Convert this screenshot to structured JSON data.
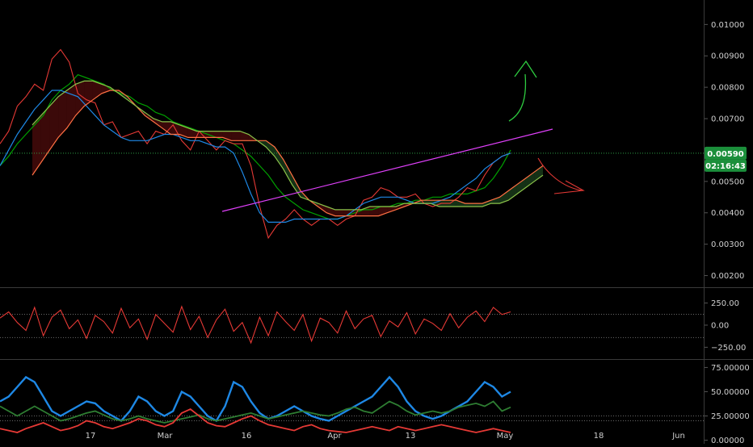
{
  "chart_data": [
    {
      "type": "line",
      "panel": "price",
      "y_ticks": [
        "0.00200",
        "0.00300",
        "0.00400",
        "0.00500",
        "0.00600",
        "0.00700",
        "0.00800",
        "0.00900",
        "0.01000"
      ],
      "y_tick_values": [
        0.002,
        0.003,
        0.004,
        0.005,
        0.006,
        0.007,
        0.008,
        0.009,
        0.01
      ],
      "ylim": [
        0.00168,
        0.01078
      ],
      "last_price_label": "0.00590",
      "last_price_value": 0.0059,
      "countdown_label": "02:16:43",
      "x_tick_labels": [
        "17",
        "Mar",
        "16",
        "Apr",
        "13",
        "May",
        "18",
        "Jun"
      ],
      "series": [
        {
          "values": [
            0.0055,
            0.0058,
            0.0062,
            0.0065,
            0.0068,
            0.0071,
            0.0076,
            0.0079,
            0.0081,
            0.0084,
            0.0083,
            0.0082,
            0.0081,
            0.0079,
            0.0078,
            0.0077,
            0.0075,
            0.0074,
            0.0072,
            0.0071,
            0.0069,
            0.0068,
            0.0067,
            0.0066,
            0.0065,
            0.0064,
            0.0063,
            0.0062,
            0.006,
            0.0058,
            0.0055,
            0.0052,
            0.0048,
            0.0045,
            0.0043,
            0.0041,
            0.004,
            0.0039,
            0.0038,
            0.0038,
            0.0039,
            0.004,
            0.0041,
            0.0041,
            0.0042,
            0.0042,
            0.0043,
            0.0043,
            0.0044,
            0.0044,
            0.0045,
            0.0045,
            0.0046,
            0.0046,
            0.0046,
            0.0047,
            0.0048,
            0.0051,
            0.0055,
            0.006
          ],
          "color": "#00a000"
        },
        {
          "values": [
            0.0062,
            0.0066,
            0.0074,
            0.0077,
            0.0081,
            0.0079,
            0.0089,
            0.0092,
            0.0088,
            0.0078,
            0.0076,
            0.0075,
            0.0068,
            0.0069,
            0.0064,
            0.0065,
            0.0066,
            0.0062,
            0.0066,
            0.0065,
            0.0068,
            0.0063,
            0.006,
            0.0066,
            0.0063,
            0.006,
            0.0063,
            0.0062,
            0.0062,
            0.0055,
            0.0042,
            0.0032,
            0.0036,
            0.0038,
            0.0041,
            0.0038,
            0.0036,
            0.0038,
            0.0038,
            0.0036,
            0.0038,
            0.0039,
            0.0044,
            0.0045,
            0.0048,
            0.0047,
            0.0045,
            0.0045,
            0.0046,
            0.0043,
            0.0042,
            0.0043,
            0.0043,
            0.0045,
            0.0048,
            0.0047,
            0.0052,
            0.0056,
            0.0058,
            0.0059
          ],
          "color": "#e53935"
        },
        {
          "values": [
            0.0055,
            0.006,
            0.0065,
            0.0069,
            0.0073,
            0.0076,
            0.0079,
            0.0079,
            0.0078,
            0.0077,
            0.0074,
            0.0071,
            0.0068,
            0.0066,
            0.0064,
            0.0063,
            0.0063,
            0.0063,
            0.0064,
            0.0065,
            0.0065,
            0.0064,
            0.0063,
            0.0063,
            0.0062,
            0.0061,
            0.0061,
            0.0059,
            0.0053,
            0.0046,
            0.004,
            0.0037,
            0.0037,
            0.0037,
            0.0038,
            0.0038,
            0.0038,
            0.0038,
            0.0038,
            0.0038,
            0.0039,
            0.0041,
            0.0043,
            0.0044,
            0.0045,
            0.0045,
            0.0045,
            0.0044,
            0.0043,
            0.0043,
            0.0043,
            0.0044,
            0.0045,
            0.0047,
            0.0049,
            0.0051,
            0.0054,
            0.0056,
            0.0058,
            0.0059
          ],
          "color": "#1e88e5"
        },
        {
          "values": [
            0.0052,
            0.0056,
            0.006,
            0.0064,
            0.0067,
            0.0071,
            0.0074,
            0.0076,
            0.0078,
            0.0079,
            0.0079,
            0.0077,
            0.0074,
            0.0071,
            0.0069,
            0.0067,
            0.0065,
            0.0065,
            0.0064,
            0.0064,
            0.0064,
            0.0064,
            0.0064,
            0.0063,
            0.0063,
            0.0063,
            0.0063,
            0.0063,
            0.0061,
            0.0057,
            0.0052,
            0.0047,
            0.0044,
            0.0042,
            0.004,
            0.0039,
            0.0039,
            0.0039,
            0.0039,
            0.0039,
            0.0039,
            0.004,
            0.0041,
            0.0042,
            0.0043,
            0.0044,
            0.0044,
            0.0044,
            0.0044,
            0.0044,
            0.0043,
            0.0043,
            0.0043,
            0.0044,
            0.0045,
            0.0047,
            0.0049,
            0.0051,
            0.0053,
            0.0055
          ],
          "color": "#ff7043"
        },
        {
          "values": [
            0.0068,
            0.0071,
            0.0074,
            0.0077,
            0.0079,
            0.0081,
            0.0082,
            0.0082,
            0.0081,
            0.008,
            0.0078,
            0.0076,
            0.0074,
            0.0072,
            0.007,
            0.0069,
            0.0069,
            0.0068,
            0.0067,
            0.0066,
            0.0066,
            0.0066,
            0.0066,
            0.0066,
            0.0066,
            0.0065,
            0.0063,
            0.0061,
            0.0058,
            0.0054,
            0.0049,
            0.0045,
            0.0044,
            0.0043,
            0.0042,
            0.0041,
            0.0041,
            0.0041,
            0.0041,
            0.0042,
            0.0042,
            0.0042,
            0.0042,
            0.0043,
            0.0043,
            0.0043,
            0.0043,
            0.0042,
            0.0042,
            0.0042,
            0.0042,
            0.0042,
            0.0042,
            0.0043,
            0.0043,
            0.0044,
            0.0046,
            0.0048,
            0.005,
            0.0052
          ],
          "color": "#8bc34a"
        }
      ]
    },
    {
      "type": "line",
      "panel": "oscillator",
      "y_ticks": [
        "250.00",
        "0.00",
        "−250.00"
      ],
      "y_tick_values": [
        250,
        0,
        -250
      ],
      "ylim": [
        -365,
        410
      ],
      "series": [
        {
          "values": [
            80,
            150,
            30,
            -60,
            200,
            -120,
            90,
            170,
            -40,
            60,
            -150,
            110,
            40,
            -90,
            190,
            -30,
            70,
            -160,
            120,
            20,
            -80,
            210,
            -50,
            100,
            -140,
            60,
            180,
            -70,
            30,
            -200,
            90,
            -120,
            150,
            40,
            -60,
            120,
            -180,
            80,
            30,
            -90,
            160,
            -40,
            70,
            110,
            -130,
            50,
            -20,
            140,
            -100,
            70,
            20,
            -60,
            130,
            -30,
            90,
            160,
            40,
            200,
            120,
            150
          ],
          "color": "#e53935"
        }
      ]
    },
    {
      "type": "line",
      "panel": "dmi-adx",
      "y_ticks": [
        "75.00000",
        "50.00000",
        "25.00000",
        "0.00000"
      ],
      "y_tick_values": [
        75,
        50,
        25,
        0
      ],
      "ylim": [
        -2,
        82
      ],
      "series": [
        {
          "values": [
            40,
            45,
            55,
            65,
            60,
            45,
            30,
            25,
            30,
            35,
            40,
            38,
            30,
            25,
            20,
            30,
            45,
            40,
            30,
            25,
            30,
            50,
            45,
            35,
            25,
            20,
            35,
            60,
            55,
            40,
            28,
            22,
            25,
            30,
            35,
            30,
            25,
            22,
            20,
            25,
            30,
            35,
            40,
            45,
            55,
            65,
            55,
            40,
            30,
            25,
            22,
            25,
            30,
            35,
            40,
            50,
            60,
            55,
            45,
            50
          ],
          "color": "#1e88e5"
        },
        {
          "values": [
            35,
            30,
            25,
            30,
            35,
            30,
            25,
            20,
            22,
            25,
            28,
            30,
            26,
            22,
            20,
            22,
            25,
            22,
            20,
            18,
            20,
            22,
            24,
            26,
            22,
            20,
            22,
            24,
            26,
            28,
            25,
            22,
            24,
            26,
            28,
            30,
            28,
            26,
            25,
            28,
            32,
            34,
            30,
            28,
            34,
            40,
            36,
            30,
            26,
            28,
            30,
            28,
            30,
            34,
            36,
            38,
            35,
            40,
            30,
            34
          ],
          "color": "#2e7d32"
        },
        {
          "values": [
            12,
            10,
            8,
            12,
            15,
            18,
            14,
            10,
            12,
            15,
            20,
            18,
            14,
            12,
            15,
            18,
            22,
            20,
            16,
            14,
            18,
            28,
            32,
            25,
            18,
            15,
            14,
            18,
            22,
            25,
            20,
            16,
            14,
            12,
            10,
            14,
            16,
            12,
            10,
            9,
            8,
            10,
            12,
            14,
            12,
            10,
            14,
            12,
            10,
            12,
            14,
            16,
            14,
            12,
            10,
            8,
            10,
            12,
            10,
            8
          ],
          "color": "#e53935"
        }
      ]
    }
  ]
}
